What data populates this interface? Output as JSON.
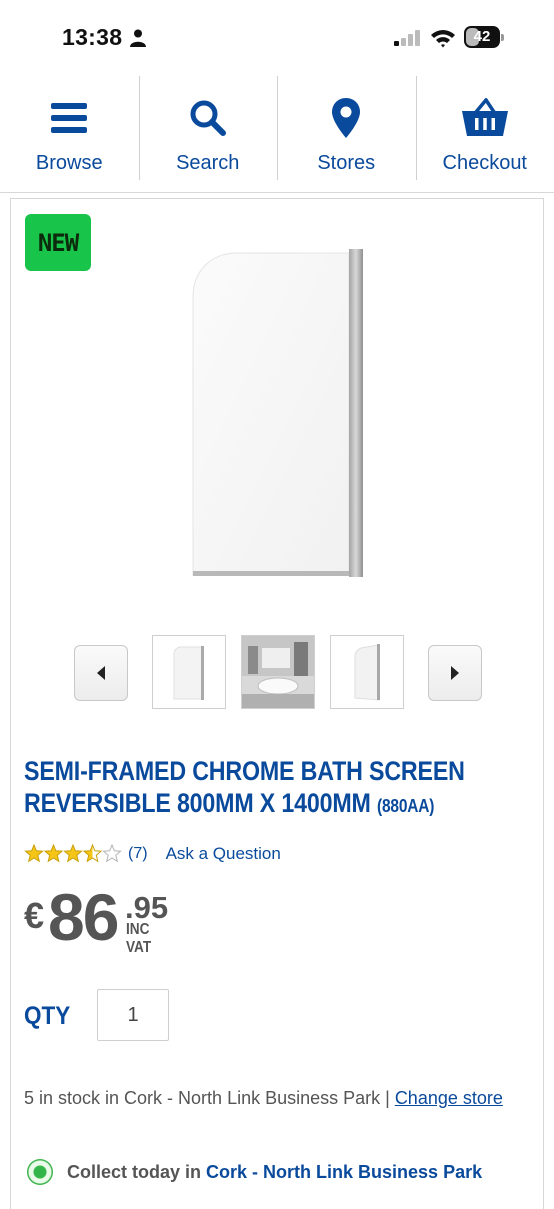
{
  "status_bar": {
    "time": "13:38",
    "battery": "42",
    "battery_level": 0.42
  },
  "nav": {
    "items": [
      {
        "label": "Browse",
        "icon": "menu-icon"
      },
      {
        "label": "Search",
        "icon": "search-icon"
      },
      {
        "label": "Stores",
        "icon": "location-pin-icon"
      },
      {
        "label": "Checkout",
        "icon": "basket-icon"
      }
    ]
  },
  "product": {
    "badge": "NEW",
    "title": "SEMI-FRAMED CHROME BATH SCREEN REVERSIBLE 800MM X 1400MM",
    "sku": "(880AA)",
    "rating": 3.5,
    "rating_max": 5,
    "review_count": "(7)",
    "ask_question": "Ask a Question",
    "price": {
      "currency": "€",
      "main": "86",
      "cents": ".95",
      "vat": "INC VAT"
    },
    "qty_label": "QTY",
    "qty_value": "1",
    "stock": {
      "text": "5 in stock in Cork - North Link Business Park | ",
      "change_link": "Change store"
    },
    "collect": {
      "prefix": "Collect today in",
      "store": "Cork - North Link Business Park"
    }
  },
  "gallery": {
    "prev_icon": "caret-left-icon",
    "next_icon": "caret-right-icon",
    "thumbnails": [
      "bath-screen-front",
      "bathroom-scene",
      "bath-screen-angle"
    ]
  },
  "colors": {
    "brand_blue": "#0a4a9c",
    "badge_green": "#19c44a",
    "star_yellow": "#f5c518"
  }
}
